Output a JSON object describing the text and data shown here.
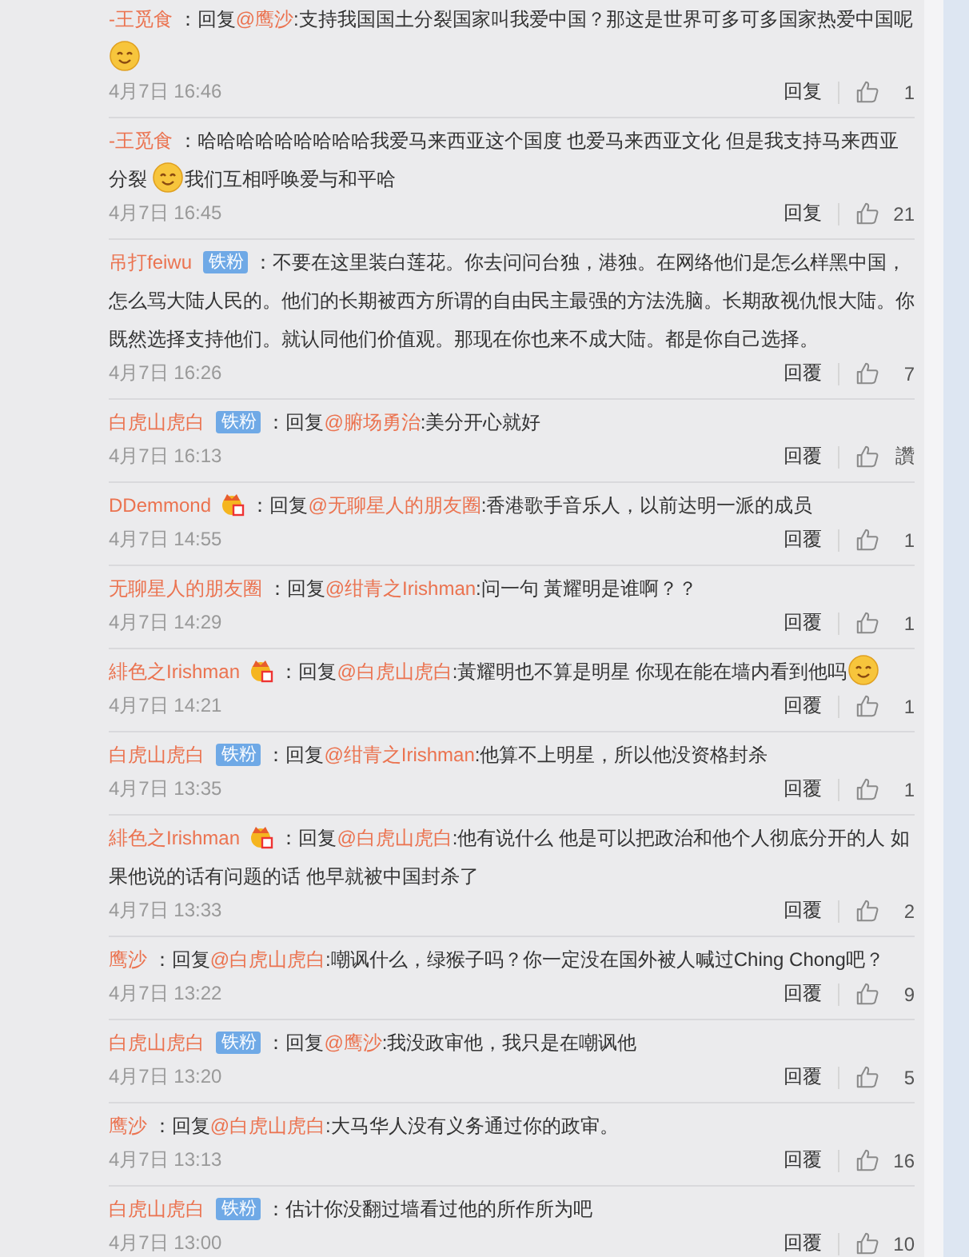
{
  "comments": [
    {
      "author": "-王觅食",
      "body": [
        {
          "kind": "text",
          "text": "：回复"
        },
        {
          "kind": "mention",
          "text": "@鹰沙"
        },
        {
          "kind": "text",
          "text": ":支持我国国土分裂国家叫我爱中国？那这是世界可多可多国家热爱中国呢"
        },
        {
          "kind": "emoji"
        }
      ],
      "time": "4月7日 16:46",
      "reply": "回复",
      "likes": "1"
    },
    {
      "author": "-王觅食",
      "body": [
        {
          "kind": "text",
          "text": "：哈哈哈哈哈哈哈哈哈我爱马来西亚这个国度 也爱马来西亚文化 但是我支持马来西亚分裂 "
        },
        {
          "kind": "emoji"
        },
        {
          "kind": "text",
          "text": "我们互相呼唤爱与和平哈"
        }
      ],
      "time": "4月7日 16:45",
      "reply": "回复",
      "likes": "21"
    },
    {
      "author": "吊打feiwu",
      "badges": [
        {
          "kind": "fan",
          "text": "铁粉"
        }
      ],
      "body": [
        {
          "kind": "text",
          "text": "：不要在这里装白莲花。你去问问台独，港独。在网络他们是怎么样黑中国，怎么骂大陆人民的。他们的长期被西方所谓的自由民主最强的方法洗脑。长期敌视仇恨大陆。你既然选择支持他们。就认同他们价值观。那现在你也来不成大陆。都是你自己选择。"
        }
      ],
      "time": "4月7日 16:26",
      "reply": "回覆",
      "likes": "7"
    },
    {
      "author": "白虎山虎白",
      "badges": [
        {
          "kind": "fan",
          "text": "铁粉"
        }
      ],
      "body": [
        {
          "kind": "text",
          "text": "：回复"
        },
        {
          "kind": "mention",
          "text": "@腑场勇治"
        },
        {
          "kind": "text",
          "text": ":美分开心就好"
        }
      ],
      "time": "4月7日 16:13",
      "reply": "回覆",
      "likes": "讚"
    },
    {
      "author": "DDemmond",
      "badges": [
        {
          "kind": "crown"
        }
      ],
      "body": [
        {
          "kind": "text",
          "text": "：回复"
        },
        {
          "kind": "mention",
          "text": "@无聊星人的朋友圈"
        },
        {
          "kind": "text",
          "text": ":香港歌手音乐人，以前达明一派的成员"
        }
      ],
      "time": "4月7日 14:55",
      "reply": "回覆",
      "likes": "1"
    },
    {
      "author": "无聊星人的朋友圈",
      "body": [
        {
          "kind": "text",
          "text": "：回复"
        },
        {
          "kind": "mention",
          "text": "@绀青之Irishman"
        },
        {
          "kind": "text",
          "text": ":问一句 黃耀明是谁啊？？"
        }
      ],
      "time": "4月7日 14:29",
      "reply": "回覆",
      "likes": "1"
    },
    {
      "author": "緋色之Irishman",
      "badges": [
        {
          "kind": "crown"
        }
      ],
      "body": [
        {
          "kind": "text",
          "text": "：回复"
        },
        {
          "kind": "mention",
          "text": "@白虎山虎白"
        },
        {
          "kind": "text",
          "text": ":黃耀明也不算是明星 你现在能在墙内看到他吗"
        },
        {
          "kind": "emoji"
        }
      ],
      "time": "4月7日 14:21",
      "reply": "回覆",
      "likes": "1"
    },
    {
      "author": "白虎山虎白",
      "badges": [
        {
          "kind": "fan",
          "text": "铁粉"
        }
      ],
      "body": [
        {
          "kind": "text",
          "text": "：回复"
        },
        {
          "kind": "mention",
          "text": "@绀青之Irishman"
        },
        {
          "kind": "text",
          "text": ":他算不上明星，所以他没资格封杀"
        }
      ],
      "time": "4月7日 13:35",
      "reply": "回覆",
      "likes": "1"
    },
    {
      "author": "緋色之Irishman",
      "badges": [
        {
          "kind": "crown"
        }
      ],
      "body": [
        {
          "kind": "text",
          "text": "：回复"
        },
        {
          "kind": "mention",
          "text": "@白虎山虎白"
        },
        {
          "kind": "text",
          "text": ":他有说什么 他是可以把政治和他个人彻底分开的人 如果他说的话有问题的话 他早就被中国封杀了"
        }
      ],
      "time": "4月7日 13:33",
      "reply": "回覆",
      "likes": "2"
    },
    {
      "author": "鹰沙",
      "body": [
        {
          "kind": "text",
          "text": "：回复"
        },
        {
          "kind": "mention",
          "text": "@白虎山虎白"
        },
        {
          "kind": "text",
          "text": ":嘲讽什么，绿猴子吗？你一定没在国外被人喊过Ching Chong吧？"
        }
      ],
      "time": "4月7日 13:22",
      "reply": "回覆",
      "likes": "9"
    },
    {
      "author": "白虎山虎白",
      "badges": [
        {
          "kind": "fan",
          "text": "铁粉"
        }
      ],
      "body": [
        {
          "kind": "text",
          "text": "：回复"
        },
        {
          "kind": "mention",
          "text": "@鹰沙"
        },
        {
          "kind": "text",
          "text": ":我没政审他，我只是在嘲讽他"
        }
      ],
      "time": "4月7日 13:20",
      "reply": "回覆",
      "likes": "5"
    },
    {
      "author": "鹰沙",
      "body": [
        {
          "kind": "text",
          "text": "：回复"
        },
        {
          "kind": "mention",
          "text": "@白虎山虎白"
        },
        {
          "kind": "text",
          "text": ":大马华人没有义务通过你的政审。"
        }
      ],
      "time": "4月7日 13:13",
      "reply": "回覆",
      "likes": "16"
    },
    {
      "author": "白虎山虎白",
      "badges": [
        {
          "kind": "fan",
          "text": "铁粉"
        }
      ],
      "body": [
        {
          "kind": "text",
          "text": "：估计你没翻过墙看过他的所作所为吧"
        }
      ],
      "time": "4月7日 13:00",
      "reply": "回覆",
      "likes": "10"
    }
  ]
}
